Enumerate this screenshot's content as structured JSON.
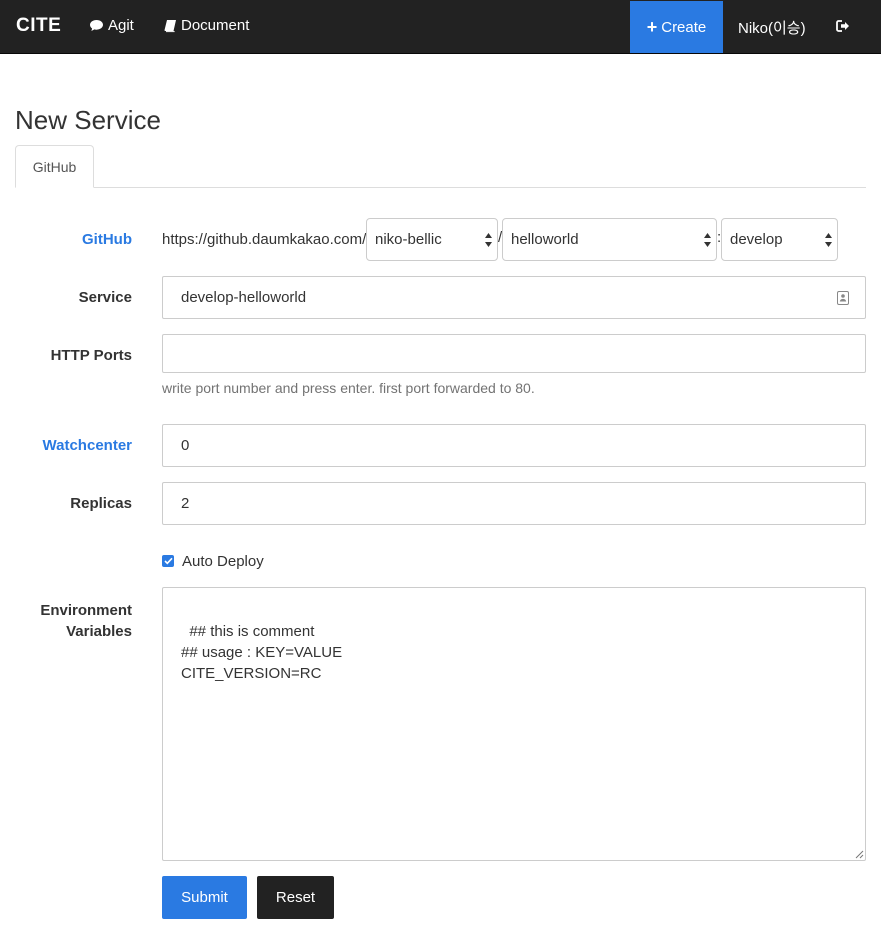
{
  "navbar": {
    "brand": "CITE",
    "agit_label": "Agit",
    "document_label": "Document",
    "create_label": "Create",
    "user_label": "Niko(이승)",
    "icons": {
      "agit": "comment-icon",
      "document": "book-icon",
      "create": "plus-icon",
      "logout": "sign-out-icon"
    },
    "colors": {
      "background": "#222222",
      "accent": "#2a7ae2"
    }
  },
  "page": {
    "title": "New Service",
    "tabs": [
      {
        "label": "GitHub",
        "active": true
      }
    ]
  },
  "form": {
    "github": {
      "label": "GitHub",
      "url_prefix": "https://github.daumkakao.com/",
      "org_value": "niko-bellic",
      "slash": "/",
      "repo_value": "helloworld",
      "colon": ":",
      "branch_value": "develop"
    },
    "service": {
      "label": "Service",
      "value": "develop-helloworld",
      "icon": "contact-card-icon"
    },
    "http_ports": {
      "label": "HTTP Ports",
      "value": "",
      "help": "write port number and press enter. first port forwarded to 80."
    },
    "watchcenter": {
      "label": "Watchcenter",
      "value": "0"
    },
    "replicas": {
      "label": "Replicas",
      "value": "2"
    },
    "auto_deploy": {
      "label": "Auto Deploy",
      "checked": true
    },
    "env": {
      "label_line1": "Environment",
      "label_line2": "Variables",
      "value": "## this is comment\n## usage : KEY=VALUE\nCITE_VERSION=RC"
    },
    "submit_label": "Submit",
    "reset_label": "Reset"
  }
}
